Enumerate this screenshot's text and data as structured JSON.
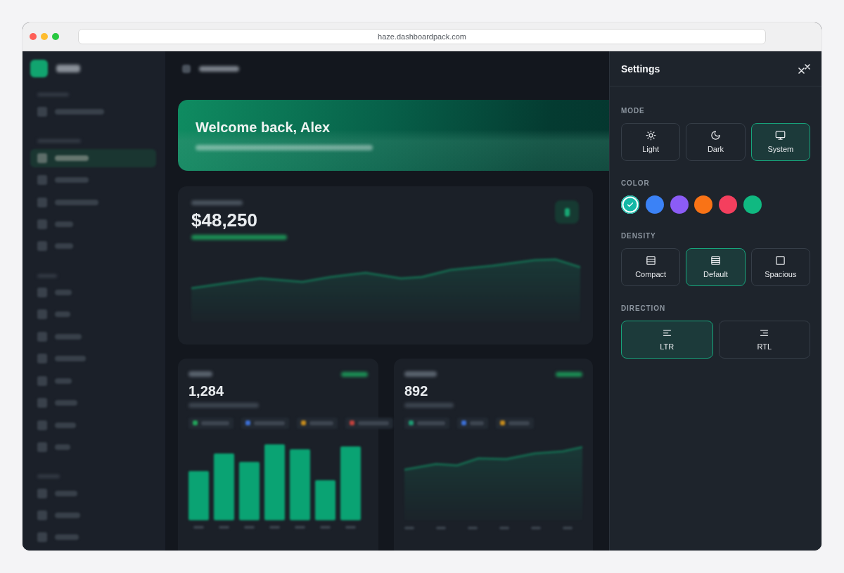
{
  "browser": {
    "url": "haze.dashboardpack.com"
  },
  "sidebar": {
    "groups": [
      {
        "items": [
          {
            "selected": false
          }
        ]
      },
      {
        "items": [
          {
            "selected": true
          },
          {
            "selected": false
          },
          {
            "selected": false
          },
          {
            "selected": false
          },
          {
            "selected": false
          }
        ]
      },
      {
        "items": [
          {
            "selected": false
          },
          {
            "selected": false
          },
          {
            "selected": false
          },
          {
            "selected": false
          },
          {
            "selected": false
          },
          {
            "selected": false
          },
          {
            "selected": false
          },
          {
            "selected": false
          }
        ]
      },
      {
        "items": [
          {
            "selected": false
          },
          {
            "selected": false
          },
          {
            "selected": false
          }
        ]
      }
    ]
  },
  "backdrop": {
    "greeting": "Welcome back, Alex",
    "revenue_value": "$48,250",
    "orders_value": "1,284",
    "customers_value": "892"
  },
  "settings": {
    "title": "Settings",
    "sections": [
      {
        "kind": "options",
        "label": "MODE",
        "options": [
          {
            "label": "Light",
            "selected": false
          },
          {
            "label": "Dark",
            "selected": false
          },
          {
            "label": "System",
            "selected": true
          }
        ]
      },
      {
        "kind": "swatches",
        "label": "COLOR",
        "swatches": [
          {
            "color": "#14b8a6",
            "selected": true
          },
          {
            "color": "#3b82f6",
            "selected": false
          },
          {
            "color": "#8b5cf6",
            "selected": false
          },
          {
            "color": "#f97316",
            "selected": false
          },
          {
            "color": "#f43f5e",
            "selected": false
          },
          {
            "color": "#10b981",
            "selected": false
          }
        ]
      },
      {
        "kind": "options",
        "label": "DENSITY",
        "options": [
          {
            "label": "Compact",
            "selected": false
          },
          {
            "label": "Default",
            "selected": true
          },
          {
            "label": "Spacious",
            "selected": false
          }
        ]
      },
      {
        "kind": "options",
        "label": "DIRECTION",
        "options": [
          {
            "label": "LTR",
            "selected": true
          },
          {
            "label": "RTL",
            "selected": false
          }
        ]
      }
    ]
  }
}
